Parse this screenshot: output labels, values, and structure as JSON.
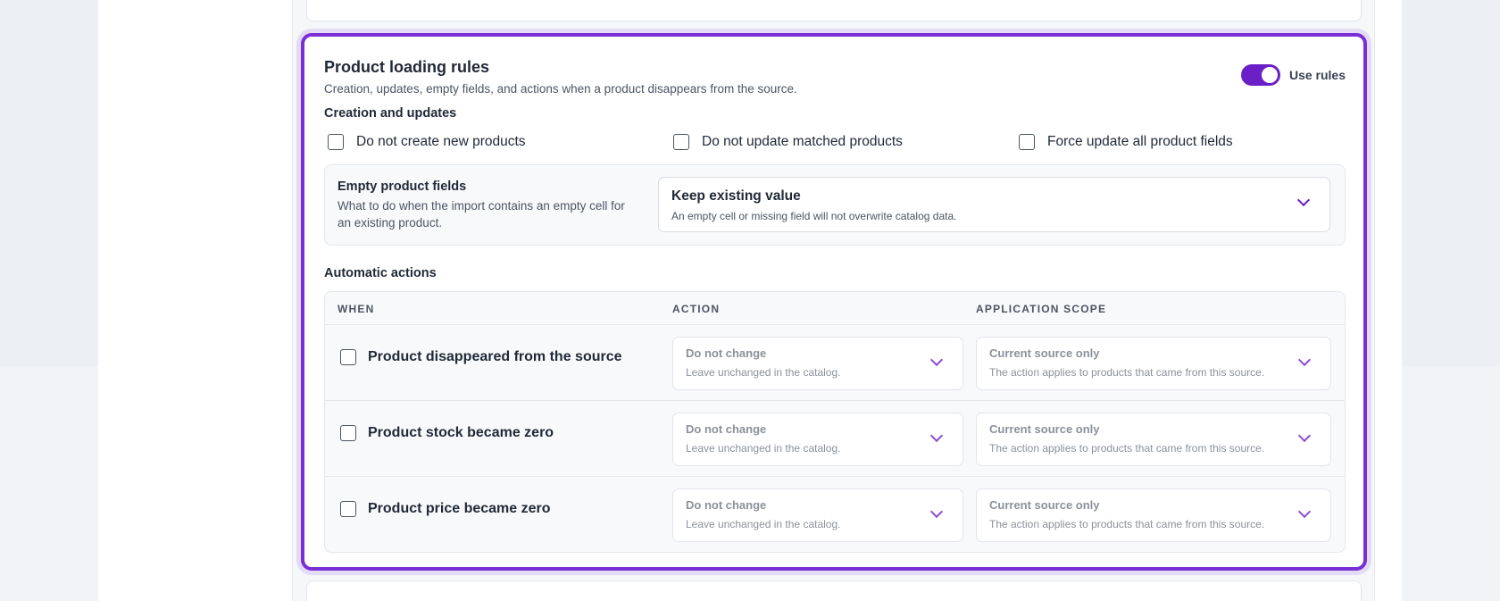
{
  "rules": {
    "title": "Product loading rules",
    "subtitle": "Creation, updates, empty fields, and actions when a product disappears from the source.",
    "toggle_label": "Use rules",
    "toggle_on": true
  },
  "creation": {
    "title": "Creation and updates",
    "options": [
      {
        "label": "Do not create new products",
        "checked": false
      },
      {
        "label": "Do not update matched products",
        "checked": false
      },
      {
        "label": "Force update all product fields",
        "checked": false
      }
    ]
  },
  "empty_fields": {
    "title": "Empty product fields",
    "description": "What to do when the import contains an empty cell for an existing product.",
    "selected": "Keep existing value",
    "selected_hint": "An empty cell or missing field will not overwrite catalog data."
  },
  "automatic": {
    "title": "Automatic actions",
    "headers": {
      "when": "WHEN",
      "action": "ACTION",
      "scope": "APPLICATION SCOPE"
    },
    "rows": [
      {
        "when": "Product disappeared from the source",
        "action": "Do not change",
        "action_hint": "Leave unchanged in the catalog.",
        "scope": "Current source only",
        "scope_hint": "The action applies to products that came from this source."
      },
      {
        "when": "Product stock became zero",
        "action": "Do not change",
        "action_hint": "Leave unchanged in the catalog.",
        "scope": "Current source only",
        "scope_hint": "The action applies to products that came from this source."
      },
      {
        "when": "Product price became zero",
        "action": "Do not change",
        "action_hint": "Leave unchanged in the catalog.",
        "scope": "Current source only",
        "scope_hint": "The action applies to products that came from this source."
      }
    ]
  },
  "colors": {
    "accent": "#7a2fd6",
    "toggle": "#6b1fc7"
  }
}
